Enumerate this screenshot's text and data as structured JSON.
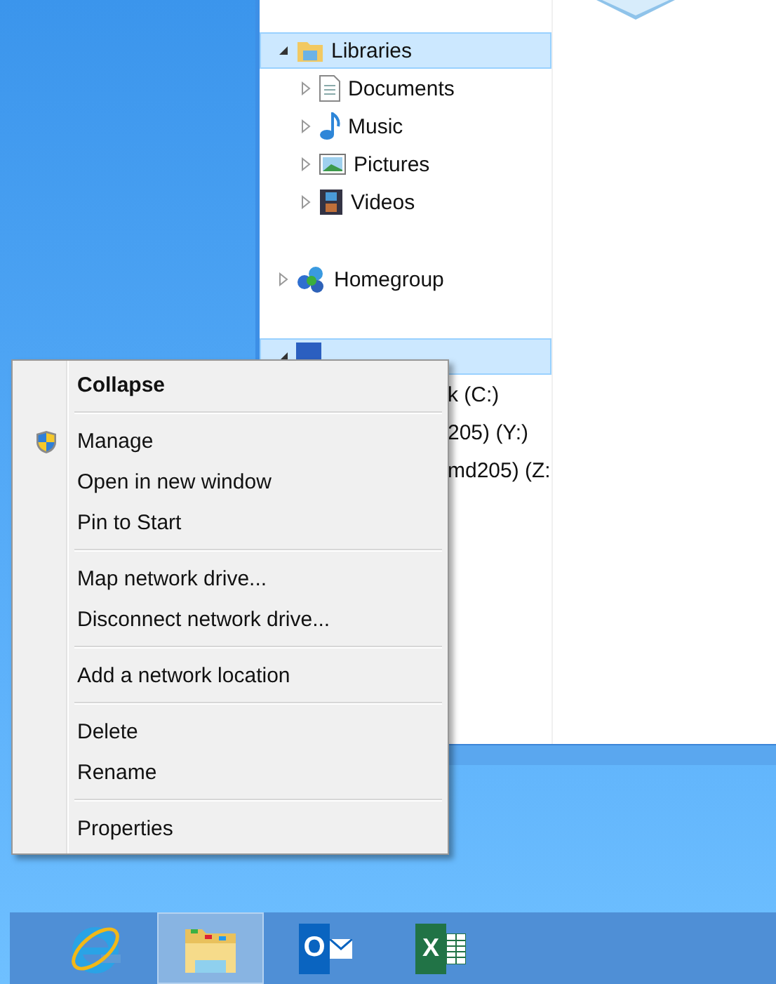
{
  "nav_pane": {
    "items": [
      {
        "label": "Libraries",
        "kind": "library",
        "expanded": true,
        "highlighted": true,
        "children": [
          {
            "label": "Documents",
            "kind": "document",
            "expanded": false
          },
          {
            "label": "Music",
            "kind": "music",
            "expanded": false
          },
          {
            "label": "Pictures",
            "kind": "pictures",
            "expanded": false
          },
          {
            "label": "Videos",
            "kind": "videos",
            "expanded": false
          }
        ]
      },
      {
        "label": "Homegroup",
        "kind": "homegroup",
        "expanded": false
      },
      {
        "kind": "computer",
        "expanded": true,
        "highlighted": true,
        "children": [
          {
            "label": "k (C:)",
            "kind": "drive"
          },
          {
            "label": "205) (Y:)",
            "kind": "drive"
          },
          {
            "label": "md205) (Z:",
            "kind": "drive"
          }
        ]
      }
    ]
  },
  "context_menu": {
    "items": [
      {
        "kind": "item",
        "label": "Collapse",
        "default": true
      },
      {
        "kind": "separator"
      },
      {
        "kind": "shield_item",
        "label": "Manage"
      },
      {
        "kind": "item",
        "label": "Open in new window"
      },
      {
        "kind": "item",
        "label": "Pin to Start"
      },
      {
        "kind": "separator"
      },
      {
        "kind": "item",
        "label": "Map network drive..."
      },
      {
        "kind": "item",
        "label": "Disconnect network drive..."
      },
      {
        "kind": "separator"
      },
      {
        "kind": "item",
        "label": "Add a network location"
      },
      {
        "kind": "separator"
      },
      {
        "kind": "item",
        "label": "Delete"
      },
      {
        "kind": "item",
        "label": "Rename"
      },
      {
        "kind": "separator"
      },
      {
        "kind": "item",
        "label": "Properties"
      }
    ]
  },
  "taskbar": {
    "items": [
      {
        "kind": "browser",
        "selected": false
      },
      {
        "kind": "explorer",
        "selected": true
      },
      {
        "kind": "mail",
        "glyph": "O",
        "selected": false
      },
      {
        "kind": "spreadsheet",
        "glyph": "X",
        "selected": false
      }
    ]
  }
}
